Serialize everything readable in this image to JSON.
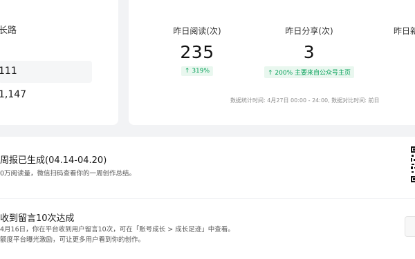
{
  "left_panel": {
    "title": "长路",
    "items": [
      {
        "label": "111",
        "selected": true
      },
      {
        "label": "1,147",
        "selected": false
      }
    ]
  },
  "stats": {
    "items": [
      {
        "label": "昨日阅读(次)",
        "value": "235",
        "badge": "↑ 319%"
      },
      {
        "label": "昨日分享(次)",
        "value": "3",
        "badge": "↑ 200%   主要来自公众号主页"
      },
      {
        "label": "昨日新",
        "value": "",
        "badge": ""
      }
    ],
    "note": "数据统计时间: 4月27日 00:00 - 24:00, 数据对比时间: 前日",
    "colors": {
      "up": "#07a15a",
      "badge_bg": "#e9f7ef"
    }
  },
  "notices": [
    {
      "title": "周报已生成(04.14-04.20)",
      "lines": [
        "0万阅读量，微信扫码查看你的一周创作总结。"
      ],
      "side": "qr-code-icon"
    },
    {
      "title": "收到留言10次达成",
      "lines": [
        "4月16日，你在平台收到用户留言10次，可在「账号成长 > 成长足迹」中查看。",
        "额度平台曝光激励，可让更多用户看到你的创作。"
      ],
      "side": "action-button"
    }
  ]
}
